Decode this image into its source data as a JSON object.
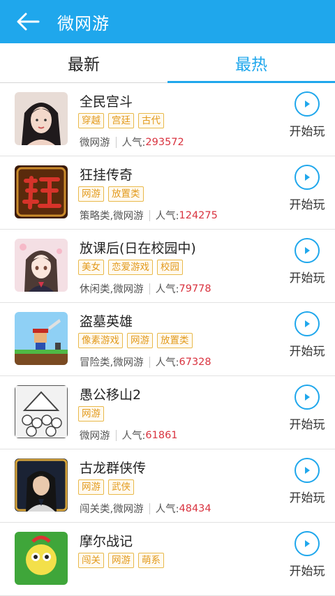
{
  "header": {
    "title": "微网游"
  },
  "tabs": [
    {
      "label": "最新",
      "active": false
    },
    {
      "label": "最热",
      "active": true
    }
  ],
  "colors": {
    "accent": "#1fa7ec",
    "tag_border": "#e9b94a",
    "tag_text": "#e29a1d",
    "popularity": "#d9333f"
  },
  "games": [
    {
      "name": "全民宫斗",
      "tags": [
        "穿越",
        "宫廷",
        "古代"
      ],
      "category": "微网游",
      "pop_label": "人气:",
      "pop_value": "293572",
      "play_label": "开始玩"
    },
    {
      "name": "狂挂传奇",
      "tags": [
        "网游",
        "放置类"
      ],
      "category": "策略类,微网游",
      "pop_label": "人气:",
      "pop_value": "124275",
      "play_label": "开始玩"
    },
    {
      "name": "放课后(日在校园中)",
      "tags": [
        "美女",
        "恋爱游戏",
        "校园"
      ],
      "category": "休闲类,微网游",
      "pop_label": "人气:",
      "pop_value": "79778",
      "play_label": "开始玩"
    },
    {
      "name": "盗墓英雄",
      "tags": [
        "像素游戏",
        "网游",
        "放置类"
      ],
      "category": "冒险类,微网游",
      "pop_label": "人气:",
      "pop_value": "67328",
      "play_label": "开始玩"
    },
    {
      "name": "愚公移山2",
      "tags": [
        "网游"
      ],
      "category": "微网游",
      "pop_label": "人气:",
      "pop_value": "61861",
      "play_label": "开始玩"
    },
    {
      "name": "古龙群侠传",
      "tags": [
        "网游",
        "武侠"
      ],
      "category": "闯关类,微网游",
      "pop_label": "人气:",
      "pop_value": "48434",
      "play_label": "开始玩"
    },
    {
      "name": "摩尔战记",
      "tags": [
        "闯关",
        "网游",
        "萌系"
      ],
      "category": "",
      "pop_label": "",
      "pop_value": "",
      "play_label": "开始玩"
    }
  ]
}
